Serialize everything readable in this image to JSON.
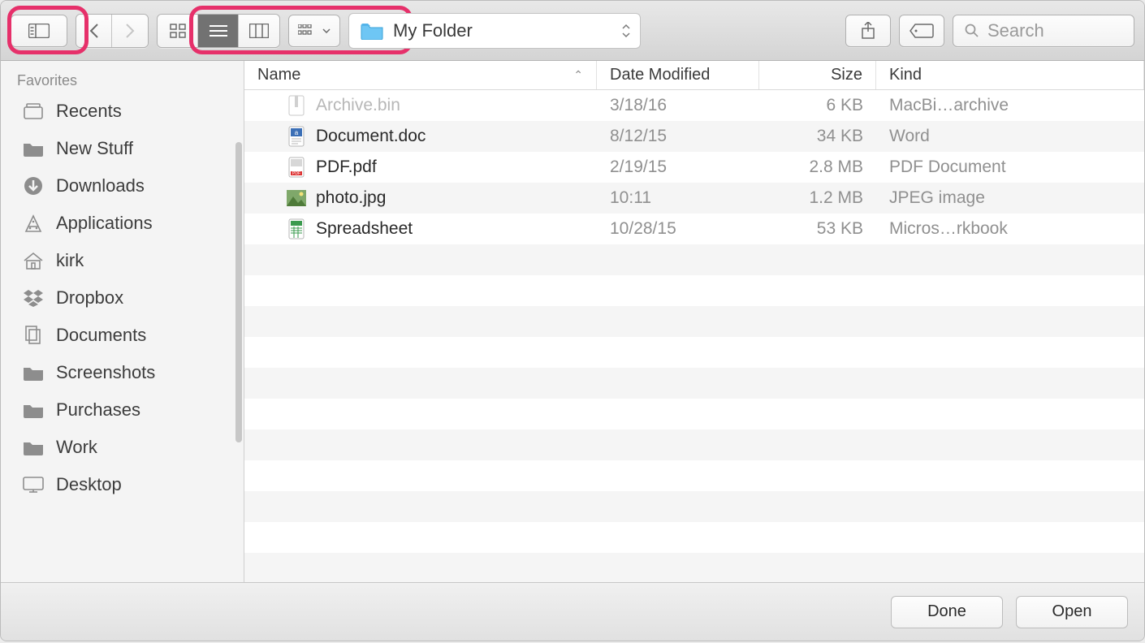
{
  "toolbar": {
    "location": "My Folder",
    "search_placeholder": "Search"
  },
  "sidebar": {
    "heading": "Favorites",
    "items": [
      {
        "label": "Recents",
        "icon": "recents"
      },
      {
        "label": "New Stuff",
        "icon": "folder"
      },
      {
        "label": "Downloads",
        "icon": "download"
      },
      {
        "label": "Applications",
        "icon": "apps"
      },
      {
        "label": "kirk",
        "icon": "home"
      },
      {
        "label": "Dropbox",
        "icon": "dropbox"
      },
      {
        "label": "Documents",
        "icon": "documents"
      },
      {
        "label": "Screenshots",
        "icon": "folder"
      },
      {
        "label": "Purchases",
        "icon": "folder"
      },
      {
        "label": "Work",
        "icon": "folder"
      },
      {
        "label": "Desktop",
        "icon": "desktop"
      }
    ]
  },
  "columns": {
    "name": "Name",
    "date": "Date Modified",
    "size": "Size",
    "kind": "Kind"
  },
  "files": [
    {
      "name": "Archive.bin",
      "date": "3/18/16",
      "size": "6 KB",
      "kind": "MacBi…archive",
      "dim": true,
      "icon": "archive"
    },
    {
      "name": "Document.doc",
      "date": "8/12/15",
      "size": "34 KB",
      "kind": "Word",
      "dim": false,
      "icon": "doc"
    },
    {
      "name": "PDF.pdf",
      "date": "2/19/15",
      "size": "2.8 MB",
      "kind": "PDF Document",
      "dim": false,
      "icon": "pdf"
    },
    {
      "name": "photo.jpg",
      "date": "10:11",
      "size": "1.2 MB",
      "kind": "JPEG image",
      "dim": false,
      "icon": "jpg"
    },
    {
      "name": "Spreadsheet",
      "date": "10/28/15",
      "size": "53 KB",
      "kind": "Micros…rkbook",
      "dim": false,
      "icon": "xls"
    }
  ],
  "footer": {
    "done": "Done",
    "open": "Open"
  }
}
